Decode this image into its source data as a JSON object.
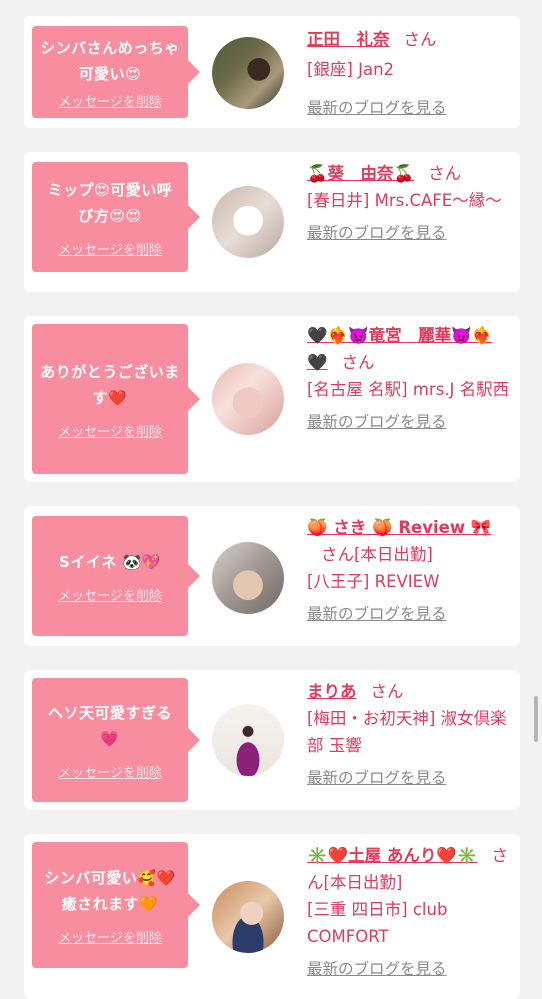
{
  "cards": [
    {
      "message": "シンバさんめっちゃ可愛い😍",
      "delete_label": "メッセージを削除",
      "name": "正田　礼奈",
      "honorific": "さん",
      "shop": "[銀座] Jan2",
      "blog_label": "最新のブログを見る"
    },
    {
      "message": "ミップ😍可愛い呼び方😍😍",
      "delete_label": "メッセージを削除",
      "name": "🍒葵　由奈🍒",
      "honorific": "さん",
      "shop": "[春日井] Mrs.CAFE〜縁〜",
      "blog_label": "最新のブログを見る"
    },
    {
      "message": "ありがとうございます❤️",
      "delete_label": "メッセージを削除",
      "name": "🖤❤️‍🔥👿竜宮　麗華👿❤️‍🔥🖤",
      "honorific": "さん",
      "shop": "[名古屋 名駅] mrs.J 名駅西",
      "blog_label": "最新のブログを見る"
    },
    {
      "message": "Sイイネ 🐼💖",
      "delete_label": "メッセージを削除",
      "name": "🍑 さき 🍑 Review 🎀",
      "honorific": "さん[本日出勤]",
      "shop": "[八王子] REVIEW",
      "blog_label": "最新のブログを見る"
    },
    {
      "message": "ヘソ天可愛すぎる💗",
      "delete_label": "メッセージを削除",
      "name": "まりあ",
      "honorific": "さん",
      "shop": "[梅田・お初天神] 淑女倶楽部 玉響",
      "blog_label": "最新のブログを見る"
    },
    {
      "message": "シンバ可愛い🥰❤️癒されます🧡",
      "delete_label": "メッセージを削除",
      "name": "✳️❤️土屋 あんり❤️✳️",
      "honorific": "さん[本日出勤]",
      "shop": "[三重 四日市] club COMFORT",
      "blog_label": "最新のブログを見る"
    }
  ],
  "colors": {
    "bubble": "#f78d9e",
    "accent": "#e23a5a",
    "link_gray": "#8a8a8a",
    "background": "#f2f2f2"
  }
}
